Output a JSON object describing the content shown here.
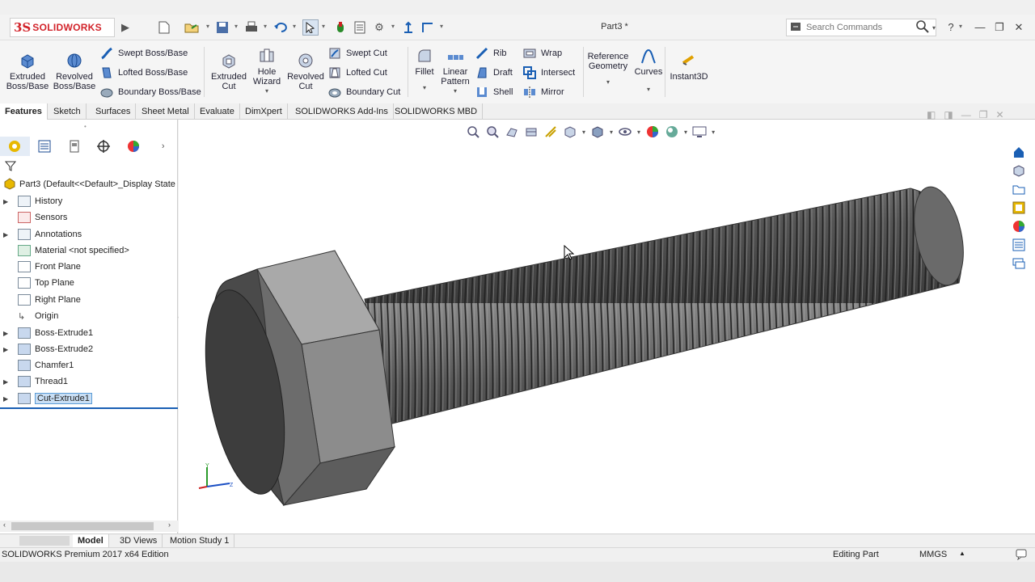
{
  "app": {
    "logo_text": "SOLIDWORKS",
    "document_title": "Part3 *"
  },
  "search": {
    "placeholder": "Search Commands"
  },
  "ribbon": {
    "extruded_boss": "Extruded Boss/Base",
    "revolved_boss": "Revolved Boss/Base",
    "swept_boss": "Swept Boss/Base",
    "lofted_boss": "Lofted Boss/Base",
    "boundary_boss": "Boundary Boss/Base",
    "extruded_cut": "Extruded Cut",
    "hole_wizard": "Hole Wizard",
    "revolved_cut": "Revolved Cut",
    "swept_cut": "Swept Cut",
    "lofted_cut": "Lofted Cut",
    "boundary_cut": "Boundary Cut",
    "fillet": "Fillet",
    "linear_pattern": "Linear Pattern",
    "rib": "Rib",
    "draft": "Draft",
    "shell": "Shell",
    "wrap": "Wrap",
    "intersect": "Intersect",
    "mirror": "Mirror",
    "reference_geometry": "Reference Geometry",
    "curves": "Curves",
    "instant3d": "Instant3D"
  },
  "tabs": [
    "Features",
    "Sketch",
    "Surfaces",
    "Sheet Metal",
    "Evaluate",
    "DimXpert",
    "SOLIDWORKS Add-Ins",
    "SOLIDWORKS MBD"
  ],
  "tree": {
    "root": "Part3  (Default<<Default>_Display State",
    "items": [
      "History",
      "Sensors",
      "Annotations",
      "Material <not specified>",
      "Front Plane",
      "Top Plane",
      "Right Plane",
      "Origin",
      "Boss-Extrude1",
      "Boss-Extrude2",
      "Chamfer1",
      "Thread1",
      "Cut-Extrude1"
    ]
  },
  "bottom_tabs": [
    "Model",
    "3D Views",
    "Motion Study 1"
  ],
  "status": {
    "edition": "SOLIDWORKS Premium 2017 x64 Edition",
    "mode": "Editing Part",
    "units": "MMGS"
  },
  "colors": {
    "brand": "#d2232a",
    "selection": "#c9dff5",
    "accent_blue": "#1a5fb4"
  }
}
